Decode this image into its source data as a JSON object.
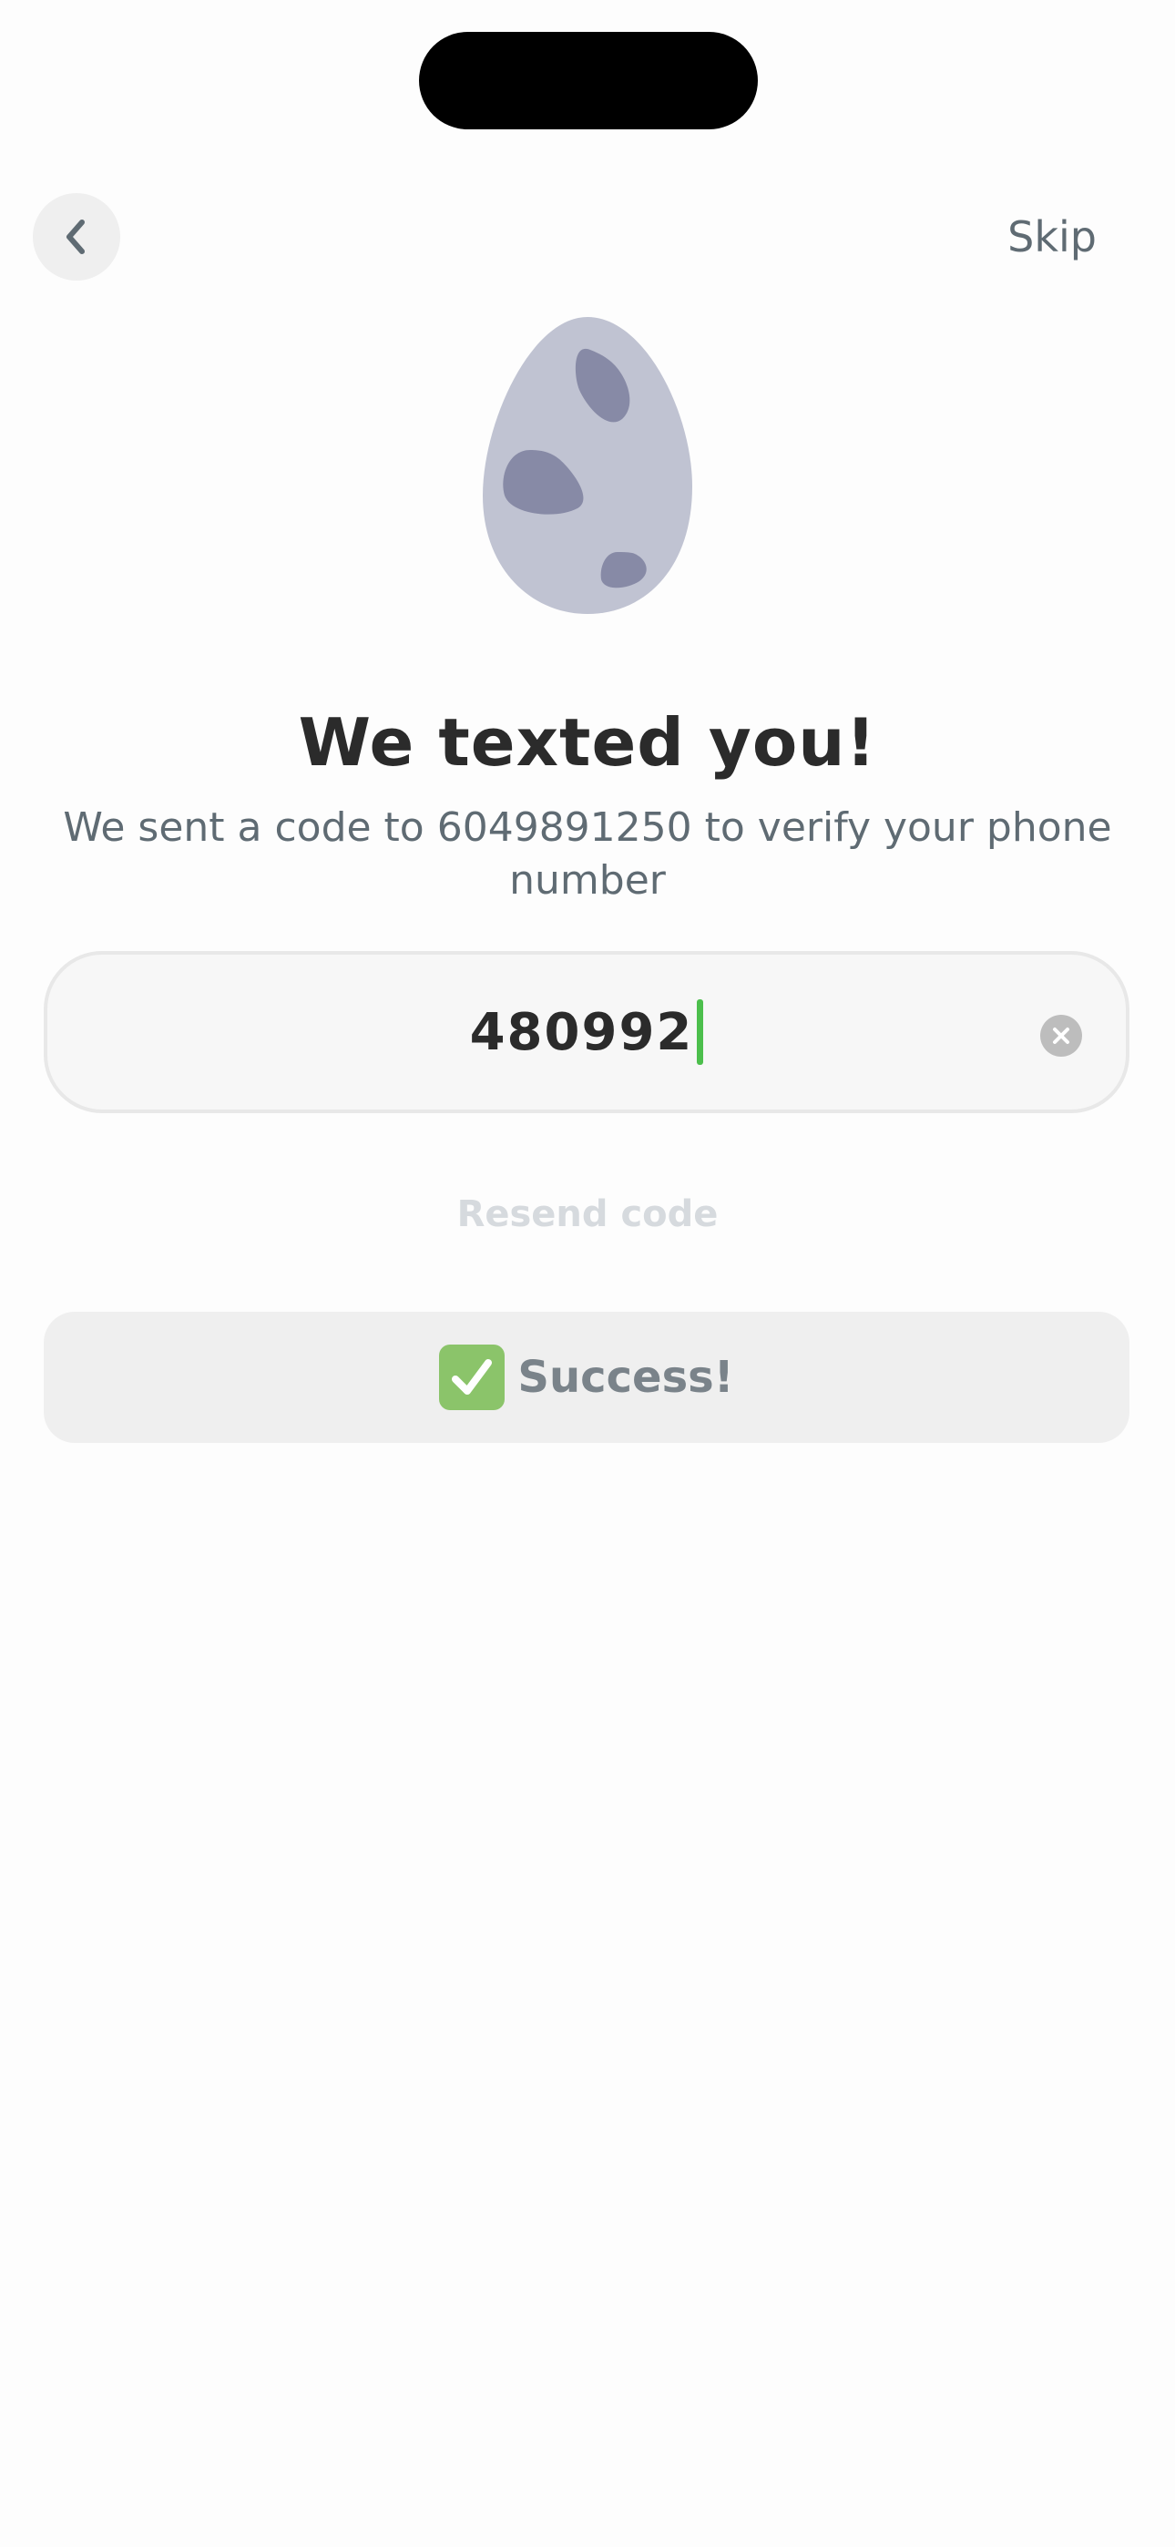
{
  "header": {
    "back_icon": "chevron-left-icon",
    "skip_label": "Skip"
  },
  "illustration": {
    "icon": "spotted-egg-icon",
    "egg_color": "#c0c3d2",
    "spot_color": "#878aa6"
  },
  "main": {
    "title": "We texted you!",
    "subtitle": "We sent a code to 6049891250 to verify your phone number"
  },
  "code_input": {
    "value": "480992",
    "clear_icon": "clear-circle-icon",
    "caret_color": "#4cbf4c"
  },
  "resend_label": "Resend code",
  "submit": {
    "icon": "checkmark-box-icon",
    "label": "Success!",
    "check_color": "#8bc46a"
  }
}
